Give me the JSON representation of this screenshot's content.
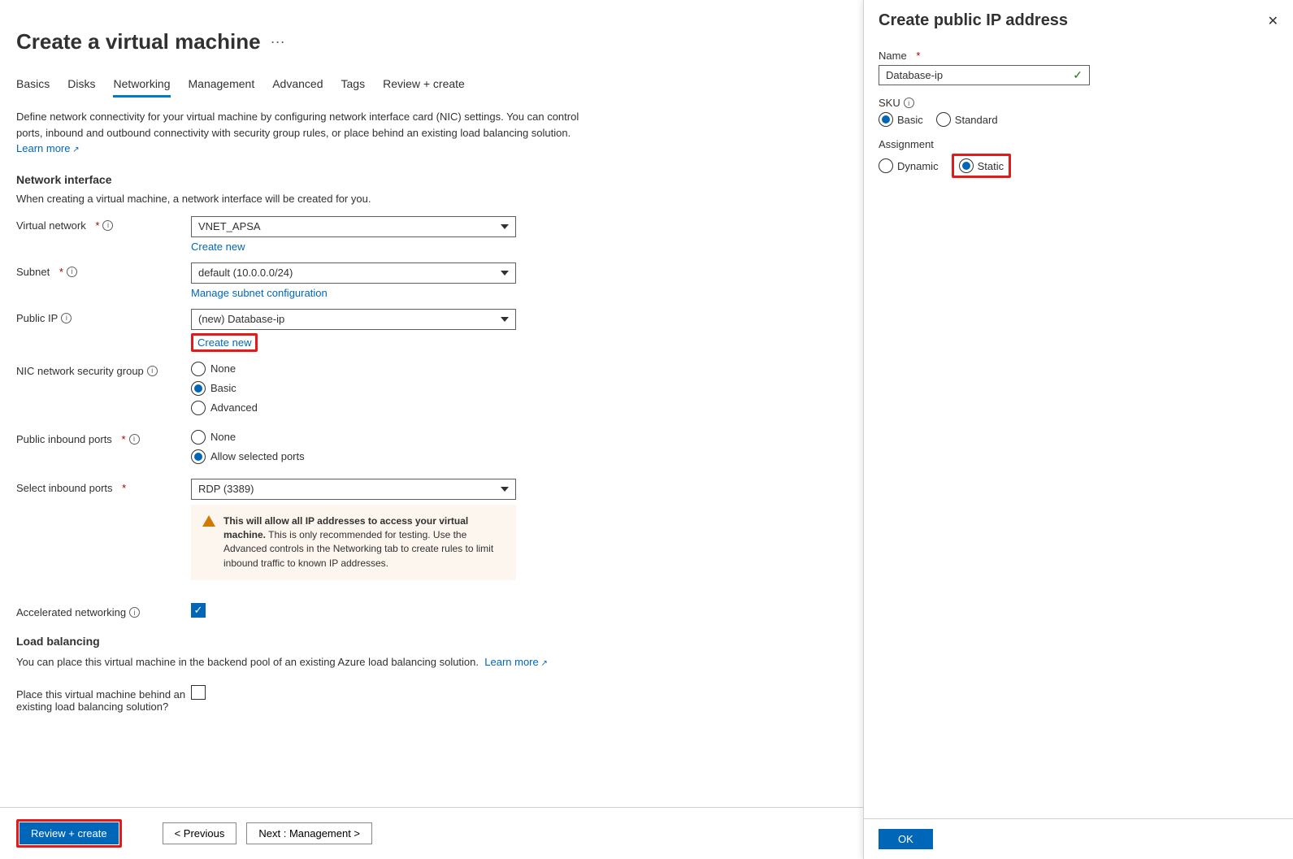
{
  "header": {
    "title": "Create a virtual machine"
  },
  "tabs": {
    "items": [
      "Basics",
      "Disks",
      "Networking",
      "Management",
      "Advanced",
      "Tags",
      "Review + create"
    ],
    "active": "Networking"
  },
  "intro": {
    "text": "Define network connectivity for your virtual machine by configuring network interface card (NIC) settings. You can control ports, inbound and outbound connectivity with security group rules, or place behind an existing load balancing solution.",
    "learn_more": "Learn more"
  },
  "network_interface": {
    "heading": "Network interface",
    "subtext": "When creating a virtual machine, a network interface will be created for you.",
    "vnet": {
      "label": "Virtual network",
      "value": "VNET_APSA",
      "create_new": "Create new"
    },
    "subnet": {
      "label": "Subnet",
      "value": "default (10.0.0.0/24)",
      "manage_link": "Manage subnet configuration"
    },
    "public_ip": {
      "label": "Public IP",
      "value": "(new) Database-ip",
      "create_new": "Create new"
    },
    "nsg": {
      "label": "NIC network security group",
      "options": [
        "None",
        "Basic",
        "Advanced"
      ],
      "selected": "Basic"
    },
    "inbound_ports": {
      "label": "Public inbound ports",
      "options": [
        "None",
        "Allow selected ports"
      ],
      "selected": "Allow selected ports"
    },
    "select_ports": {
      "label": "Select inbound ports",
      "value": "RDP (3389)"
    },
    "warning": {
      "bold": "This will allow all IP addresses to access your virtual machine.",
      "rest": "This is only recommended for testing.  Use the Advanced controls in the Networking tab to create rules to limit inbound traffic to known IP addresses."
    },
    "accelerated": {
      "label": "Accelerated networking",
      "checked": true
    }
  },
  "load_balancing": {
    "heading": "Load balancing",
    "desc": "You can place this virtual machine in the backend pool of an existing Azure load balancing solution.",
    "learn_more": "Learn more",
    "place_label": "Place this virtual machine behind an existing load balancing solution?",
    "checked": false
  },
  "footer": {
    "review": "Review + create",
    "previous": "< Previous",
    "next": "Next : Management >"
  },
  "side_panel": {
    "title": "Create public IP address",
    "name_label": "Name",
    "name_value": "Database-ip",
    "sku_label": "SKU",
    "sku_options": [
      "Basic",
      "Standard"
    ],
    "sku_selected": "Basic",
    "assignment_label": "Assignment",
    "assignment_options": [
      "Dynamic",
      "Static"
    ],
    "assignment_selected": "Static",
    "ok": "OK"
  }
}
